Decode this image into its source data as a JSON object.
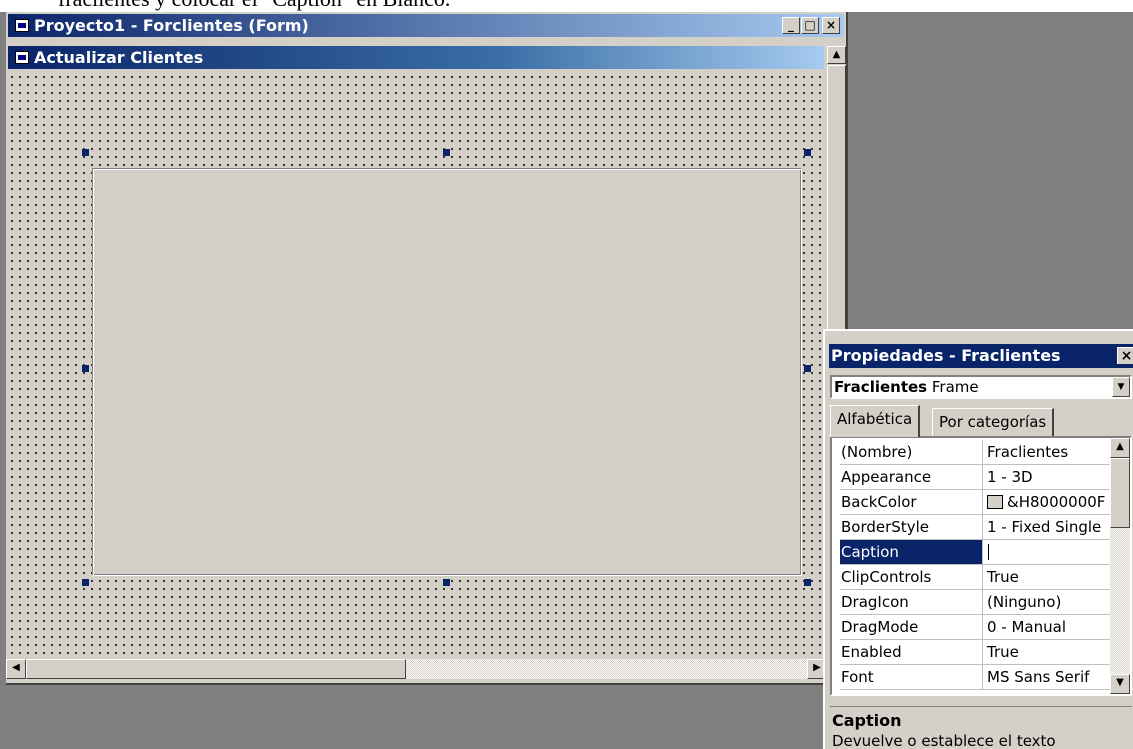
{
  "document": {
    "text": "fraclientes y colocar el \"Caption\" en Blanco."
  },
  "form_window": {
    "title": "Proyecto1 - Forclientes (Form)",
    "buttons": {
      "minimize": "_",
      "maximize": "□",
      "close": "×"
    }
  },
  "form": {
    "caption": "Actualizar Clientes",
    "selected_control": "Fraclientes"
  },
  "properties_window": {
    "title": "Propiedades - Fraclientes",
    "close": "×",
    "object": {
      "name": "Fraclientes",
      "type": "Frame"
    },
    "tabs": {
      "alphabetic": "Alfabética",
      "categorized": "Por categorías"
    },
    "rows": [
      {
        "name": "(Nombre)",
        "value": "Fraclientes"
      },
      {
        "name": "Appearance",
        "value": "1 - 3D"
      },
      {
        "name": "BackColor",
        "value": "&H8000000F"
      },
      {
        "name": "BorderStyle",
        "value": "1 - Fixed Single"
      },
      {
        "name": "Caption",
        "value": ""
      },
      {
        "name": "ClipControls",
        "value": "True"
      },
      {
        "name": "DragIcon",
        "value": "(Ninguno)"
      },
      {
        "name": "DragMode",
        "value": "0 - Manual"
      },
      {
        "name": "Enabled",
        "value": "True"
      },
      {
        "name": "Font",
        "value": "MS Sans Serif"
      }
    ],
    "selected_row": "Caption",
    "description": {
      "title": "Caption",
      "text": "Devuelve o establece el texto"
    }
  },
  "colors": {
    "title_active": "#0a246a",
    "face": "#d4d0c8",
    "selection": "#0a246a",
    "desktop": "#808080"
  }
}
